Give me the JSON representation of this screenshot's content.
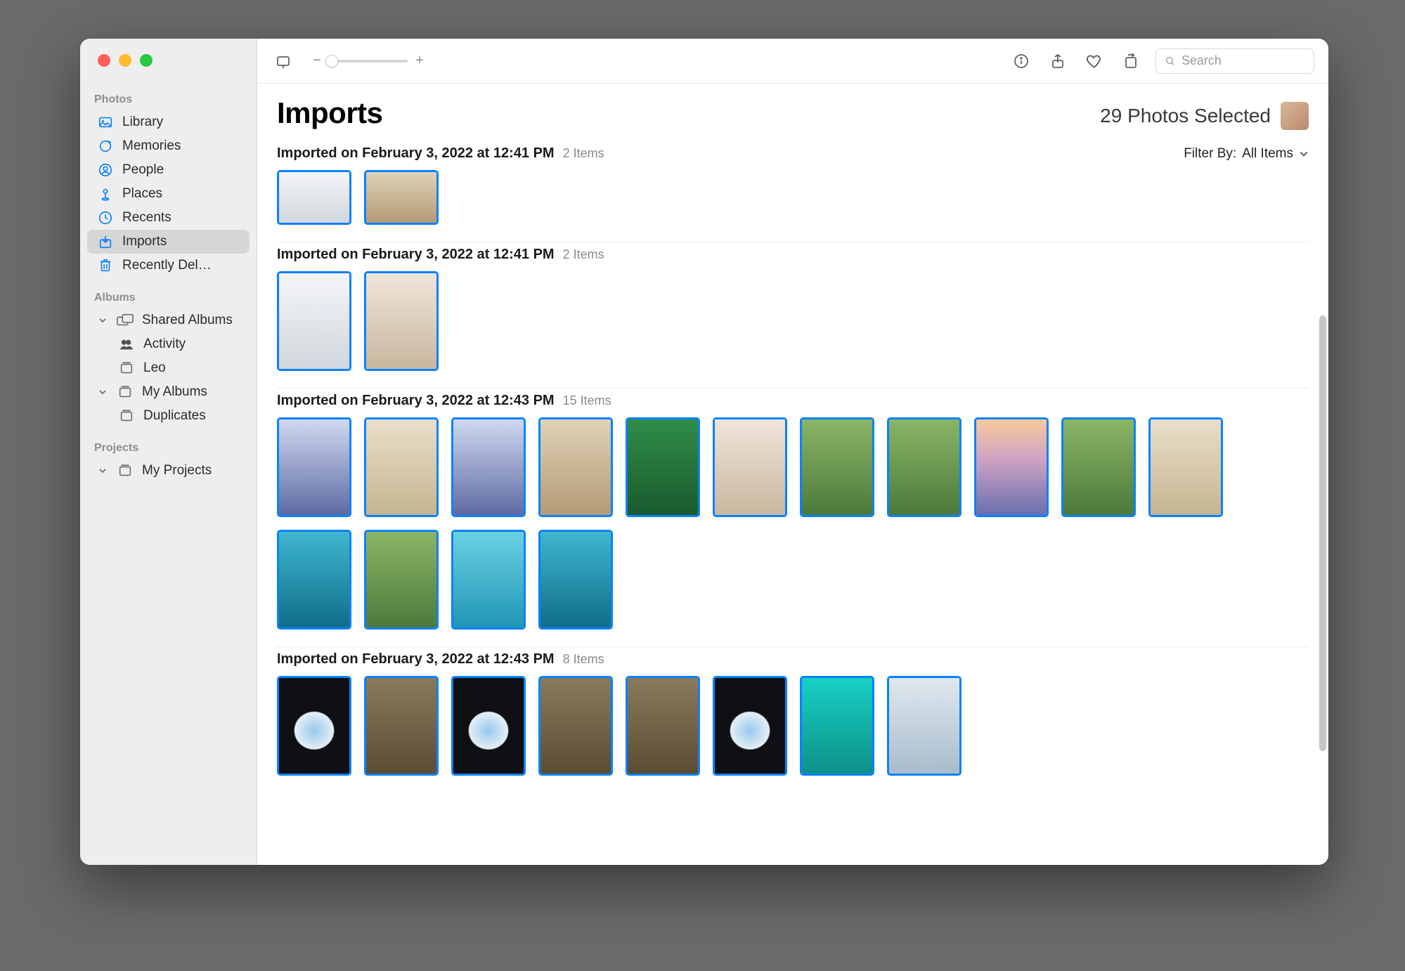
{
  "sidebar": {
    "sections": [
      {
        "heading": "Photos",
        "items": [
          {
            "id": "library",
            "label": "Library",
            "icon": "library"
          },
          {
            "id": "memories",
            "label": "Memories",
            "icon": "memories"
          },
          {
            "id": "people",
            "label": "People",
            "icon": "people"
          },
          {
            "id": "places",
            "label": "Places",
            "icon": "places"
          },
          {
            "id": "recents",
            "label": "Recents",
            "icon": "recents"
          },
          {
            "id": "imports",
            "label": "Imports",
            "icon": "imports",
            "selected": true
          },
          {
            "id": "recently-deleted",
            "label": "Recently Del…",
            "icon": "trash"
          }
        ]
      },
      {
        "heading": "Albums",
        "items": [
          {
            "id": "shared-albums",
            "label": "Shared Albums",
            "icon": "shared",
            "disclosure": "open"
          },
          {
            "id": "activity",
            "label": "Activity",
            "icon": "activity",
            "indent": true
          },
          {
            "id": "leo",
            "label": "Leo",
            "icon": "album",
            "indent": true
          },
          {
            "id": "my-albums",
            "label": "My Albums",
            "icon": "album",
            "disclosure": "open"
          },
          {
            "id": "duplicates",
            "label": "Duplicates",
            "icon": "album",
            "indent": true
          }
        ]
      },
      {
        "heading": "Projects",
        "items": [
          {
            "id": "my-projects",
            "label": "My Projects",
            "icon": "album",
            "disclosure": "open"
          }
        ]
      }
    ]
  },
  "toolbar": {
    "search_placeholder": "Search"
  },
  "page": {
    "title": "Imports",
    "selection_text": "29 Photos Selected",
    "filter_label": "Filter By:",
    "filter_value": "All Items",
    "sections": [
      {
        "title": "Imported on February 3, 2022 at 12:41 PM",
        "count_label": "2 Items",
        "show_filter": true,
        "cropped": true,
        "thumbs": [
          "snow",
          "indoor1"
        ]
      },
      {
        "title": "Imported on February 3, 2022 at 12:41 PM",
        "count_label": "2 Items",
        "thumbs": [
          "snow",
          "indoor2"
        ]
      },
      {
        "title": "Imported on February 3, 2022 at 12:43 PM",
        "count_label": "15 Items",
        "thumbs": [
          "building",
          "beach",
          "building",
          "indoor1",
          "green",
          "indoor2",
          "grass",
          "grass",
          "sunset",
          "grass",
          "beach",
          "ocean",
          "grass",
          "pool",
          "ocean"
        ]
      },
      {
        "title": "Imported on February 3, 2022 at 12:43 PM",
        "count_label": "8 Items",
        "thumbs": [
          "plane",
          "rocks",
          "plane",
          "rocks",
          "rocks",
          "plane",
          "turq",
          "boat"
        ]
      }
    ]
  }
}
